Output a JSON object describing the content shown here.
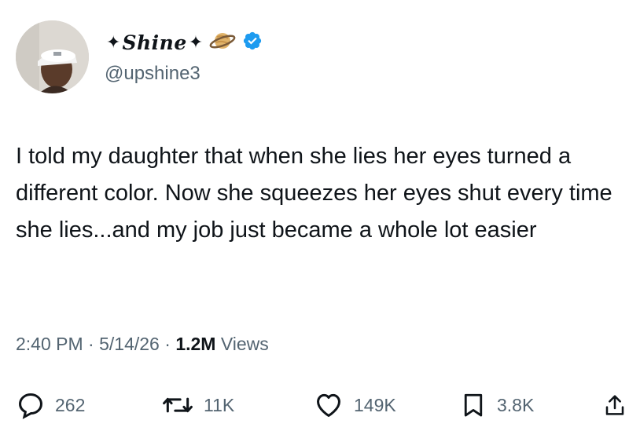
{
  "author": {
    "display_name": "Shine",
    "sparkle_glyph": "✦",
    "handle": "@upshine3",
    "verified": true,
    "verified_color": "#1d9bf0"
  },
  "tweet": {
    "text": "I told my daughter that when she lies her eyes turned a different color. Now she squeezes her eyes shut every time she lies...and my job just became a whole lot easier"
  },
  "meta": {
    "time": "2:40 PM",
    "sep1": "·",
    "date": "5/14/26",
    "sep2": "·",
    "views_count": "1.2M",
    "views_label": "Views"
  },
  "actions": {
    "replies": "262",
    "reposts": "11K",
    "likes": "149K",
    "bookmarks": "3.8K"
  },
  "icons": {
    "reply": "speech-bubble-icon",
    "repost": "retweet-arrows-icon",
    "like": "heart-icon",
    "bookmark": "bookmark-icon",
    "share": "share-upload-icon",
    "planet": "ringed-planet-emoji",
    "verified": "verified-badge-icon"
  }
}
